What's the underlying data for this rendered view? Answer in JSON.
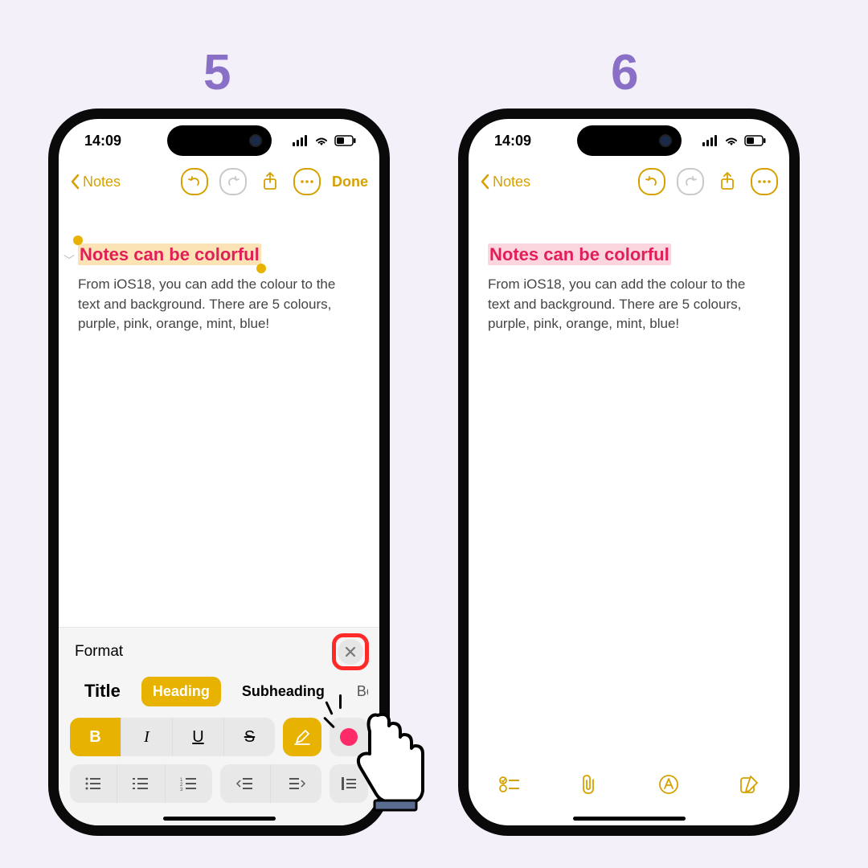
{
  "steps": {
    "left": "5",
    "right": "6"
  },
  "status": {
    "time": "14:09"
  },
  "nav": {
    "back_label": "Notes",
    "done_label": "Done"
  },
  "note": {
    "title": "Notes can be colorful",
    "body": "From iOS18, you can add the colour to the text and background. There are 5 colours, purple, pink, orange, mint, blue!"
  },
  "format_panel": {
    "header": "Format",
    "styles": {
      "title": "Title",
      "heading": "Heading",
      "subheading": "Subheading",
      "body": "Body"
    },
    "bius": {
      "b": "B",
      "i": "I",
      "u": "U",
      "s": "S"
    }
  },
  "colors": {
    "accent": "#d6a100",
    "title_text": "#e21f58",
    "highlight_pink": "#fcd6df",
    "highlight_orange": "#fbe3b6",
    "red_ring": "#ff2a2a"
  }
}
